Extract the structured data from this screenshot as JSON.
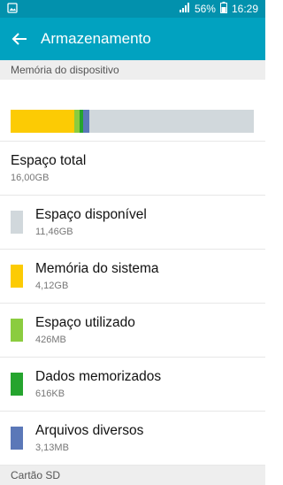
{
  "status": {
    "battery": "56%",
    "time": "16:29"
  },
  "header": {
    "title": "Armazenamento"
  },
  "section1": {
    "title": "Memória do dispositivo"
  },
  "storage_bar": [
    {
      "name": "system",
      "fraction": 0.26,
      "color": "#fccb04"
    },
    {
      "name": "used",
      "fraction": 0.025,
      "color": "#8bcc3f"
    },
    {
      "name": "cached",
      "fraction": 0.012,
      "color": "#25a42e"
    },
    {
      "name": "misc",
      "fraction": 0.028,
      "color": "#5b78b8"
    },
    {
      "name": "available",
      "fraction": 0.675,
      "color": "#d1d8dc"
    }
  ],
  "total": {
    "label": "Espaço total",
    "value": "16,00GB"
  },
  "items": [
    {
      "label": "Espaço disponível",
      "value": "11,46GB",
      "color": "#d1d8dc"
    },
    {
      "label": "Memória do sistema",
      "value": "4,12GB",
      "color": "#fccb04"
    },
    {
      "label": "Espaço utilizado",
      "value": "426MB",
      "color": "#8bcc3f"
    },
    {
      "label": "Dados memorizados",
      "value": "616KB",
      "color": "#25a42e"
    },
    {
      "label": "Arquivos diversos",
      "value": "3,13MB",
      "color": "#5b78b8"
    }
  ],
  "section2": {
    "title": "Cartão SD"
  }
}
